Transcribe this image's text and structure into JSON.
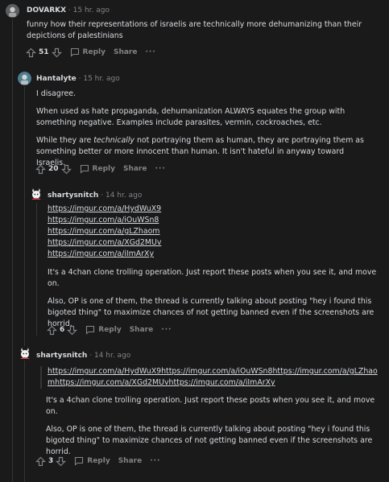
{
  "comments": [
    {
      "user": "DOVARKX",
      "time": "· 15 hr. ago",
      "text": "funny how their representations of israelis are technically more dehumanizing than their depictions of palestinians",
      "votes": "51",
      "reply": "Reply",
      "share": "Share",
      "more": "···"
    },
    {
      "user": "Hantalyte",
      "time": "· 15 hr. ago",
      "p1": "I disagree.",
      "p2": "When used as hate propaganda, dehumanization ALWAYS equates the group with something negative. Examples include parasites, vermin, cockroaches, etc.",
      "p3a": "While they are ",
      "p3em": "technically",
      "p3b": " not portraying them as human, they are portraying them as something better or more innocent than human. It isn't hateful in anyway toward Israelis.",
      "votes": "20",
      "reply": "Reply",
      "share": "Share",
      "more": "···"
    },
    {
      "user": "shartysnitch",
      "time": "· 14 hr. ago",
      "links": [
        "https://imgur.com/a/HydWuX9",
        "https://imgur.com/a/iOuWSn8",
        "https://imgur.com/a/gLZhaom",
        "https://imgur.com/a/XGd2MUv",
        "https://imgur.com/a/iImArXy"
      ],
      "p1": "It's a 4chan clone trolling operation. Just report these posts when you see it, and move on.",
      "p2": "Also, OP is one of them, the thread is currently talking about posting \"hey i found this bigoted thing\" to maximize chances of not getting banned even if the screenshots are horrid.",
      "votes": "6",
      "reply": "Reply",
      "share": "Share",
      "more": "···"
    },
    {
      "user": "shartysnitch",
      "time": "· 14 hr. ago",
      "quote_line1": "https://imgur.com/a/HydWuX9https://imgur.com/a/iOuWSn8https://imgur.com/a/gLZhao",
      "quote_line2": "mhttps://imgur.com/a/XGd2MUvhttps://imgur.com/a/iImArXy",
      "p1": "It's a 4chan clone trolling operation. Just report these posts when you see it, and move on.",
      "p2": "Also, OP is one of them, the thread is currently talking about posting \"hey i found this bigoted thing\" to maximize chances of not getting banned even if the screenshots are horrid.",
      "votes": "3",
      "reply": "Reply",
      "share": "Share",
      "more": "···"
    }
  ],
  "colors": {
    "background": "#1a1a1b",
    "text": "#d7dadc",
    "muted": "#818384",
    "thread_line": "#343536"
  }
}
